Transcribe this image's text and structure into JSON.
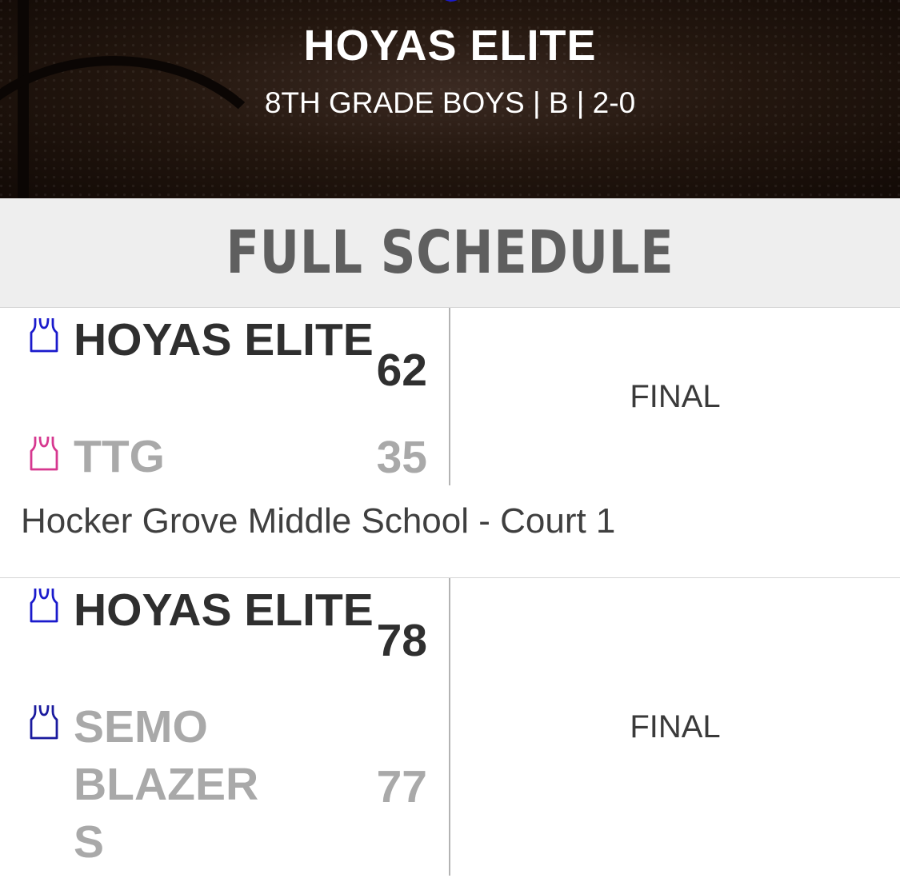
{
  "header": {
    "team_name": "HOYAS ELITE",
    "subtitle": "8TH GRADE BOYS | B | 2-0"
  },
  "schedule": {
    "title": "FULL SCHEDULE"
  },
  "games": [
    {
      "team1": {
        "name": "HOYAS ELITE",
        "score": "62",
        "jersey_color": "#1a1acc",
        "icon": "jersey-icon"
      },
      "team2": {
        "name": "TTG",
        "score": "35",
        "jersey_color": "#d6378f",
        "icon": "jersey-icon"
      },
      "status": "FINAL",
      "venue": "Hocker Grove Middle School - Court 1"
    },
    {
      "team1": {
        "name": "HOYAS ELITE",
        "score": "78",
        "jersey_color": "#1a1acc",
        "icon": "jersey-icon"
      },
      "team2": {
        "name": "SEMO BLAZER S",
        "score": "77",
        "jersey_color": "#1a1a9e",
        "icon": "jersey-icon"
      },
      "status": "FINAL"
    }
  ]
}
